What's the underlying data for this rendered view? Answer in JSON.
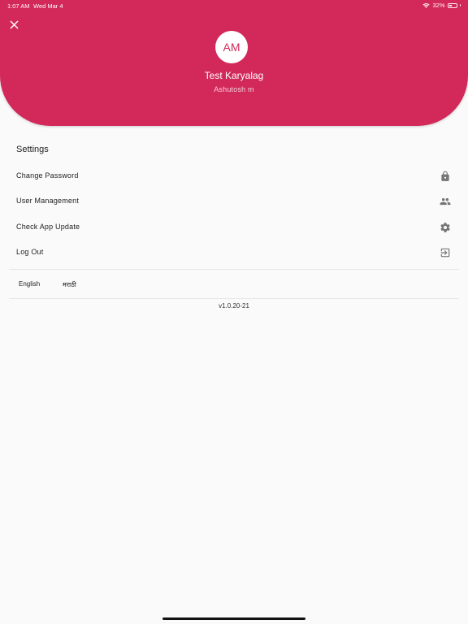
{
  "status_bar": {
    "time": "1:07 AM",
    "date": "Wed Mar 4",
    "battery": "32%"
  },
  "header": {
    "avatar_initials": "AM",
    "org_name": "Test Karyalag",
    "user_name": "Ashutosh m"
  },
  "settings": {
    "title": "Settings",
    "items": [
      {
        "label": "Change Password",
        "icon": "lock-icon"
      },
      {
        "label": "User Management",
        "icon": "people-icon"
      },
      {
        "label": "Check App Update",
        "icon": "gear-icon"
      },
      {
        "label": "Log Out",
        "icon": "logout-icon"
      }
    ]
  },
  "languages": [
    "English",
    "मराठी"
  ],
  "version": "v1.0.20-21",
  "colors": {
    "accent": "#d2285a",
    "icon": "#757575"
  }
}
